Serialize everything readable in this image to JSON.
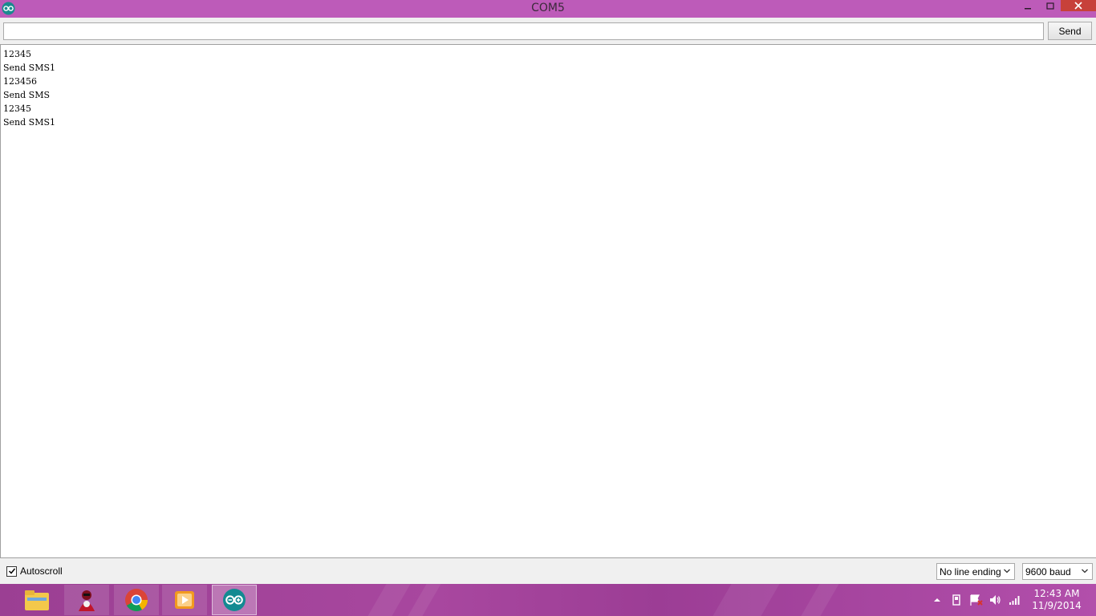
{
  "window": {
    "title": "COM5",
    "accent_color": "#bd5bb9",
    "close_color": "#c7413a"
  },
  "send": {
    "input_value": "",
    "button_label": "Send"
  },
  "output": {
    "lines": [
      "12345",
      "Send SMS1",
      "123456",
      "Send SMS",
      "12345",
      "Send SMS1"
    ]
  },
  "footer": {
    "autoscroll_label": "Autoscroll",
    "autoscroll_checked": true,
    "line_ending": "No line ending",
    "baud": "9600 baud"
  },
  "taskbar": {
    "apps": [
      "file-explorer-icon",
      "hacker-app-icon",
      "chrome-icon",
      "media-player-icon",
      "arduino-icon"
    ],
    "tray_icons": [
      "show-hidden-icons-icon",
      "power-icon",
      "action-center-flag-icon",
      "volume-icon",
      "network-signal-icon"
    ],
    "clock_time": "12:43 AM",
    "clock_date": "11/9/2014"
  }
}
